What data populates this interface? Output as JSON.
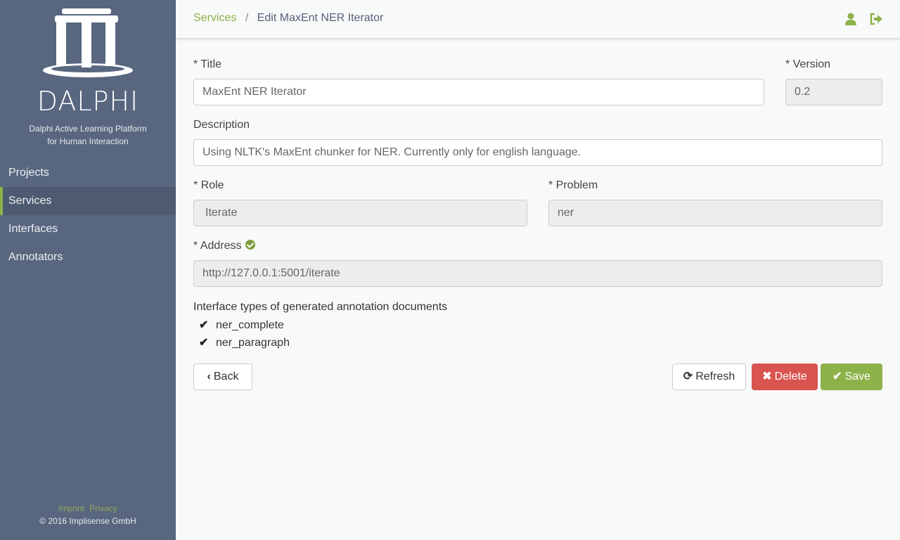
{
  "sidebar": {
    "brand": "DALPHI",
    "tagline_line1": "Dalphi Active Learning Platform",
    "tagline_line2": "for Human Interaction",
    "items": [
      {
        "label": "Projects",
        "active": false
      },
      {
        "label": "Services",
        "active": true
      },
      {
        "label": "Interfaces",
        "active": false
      },
      {
        "label": "Annotators",
        "active": false
      }
    ],
    "footer": {
      "imprint": "Imprint",
      "privacy": "Privacy",
      "copyright": "© 2016 Implisense GmbH"
    }
  },
  "header": {
    "breadcrumb_link": "Services",
    "breadcrumb_separator": "/",
    "breadcrumb_current": "Edit MaxEnt NER Iterator",
    "icons": [
      "user-icon",
      "sign-out-icon"
    ]
  },
  "form": {
    "title_label": "* Title",
    "title_value": "MaxEnt NER Iterator",
    "version_label": "* Version",
    "version_value": "0.2",
    "description_label": "Description",
    "description_value": "Using NLTK's MaxEnt chunker for NER. Currently only for english language.",
    "role_label": "* Role",
    "role_value": "Iterate",
    "problem_label": "* Problem",
    "problem_value": "ner",
    "address_label": "* Address",
    "address_status": "verified",
    "address_value": "http://127.0.0.1:5001/iterate",
    "interface_types_label": "Interface types of generated annotation documents",
    "interface_types": [
      "ner_complete",
      "ner_paragraph"
    ]
  },
  "actions": {
    "back": "Back",
    "refresh": "Refresh",
    "delete": "Delete",
    "save": "Save"
  },
  "colors": {
    "accent": "#8db24a",
    "sidebar": "#58667f",
    "danger": "#d9534f"
  }
}
